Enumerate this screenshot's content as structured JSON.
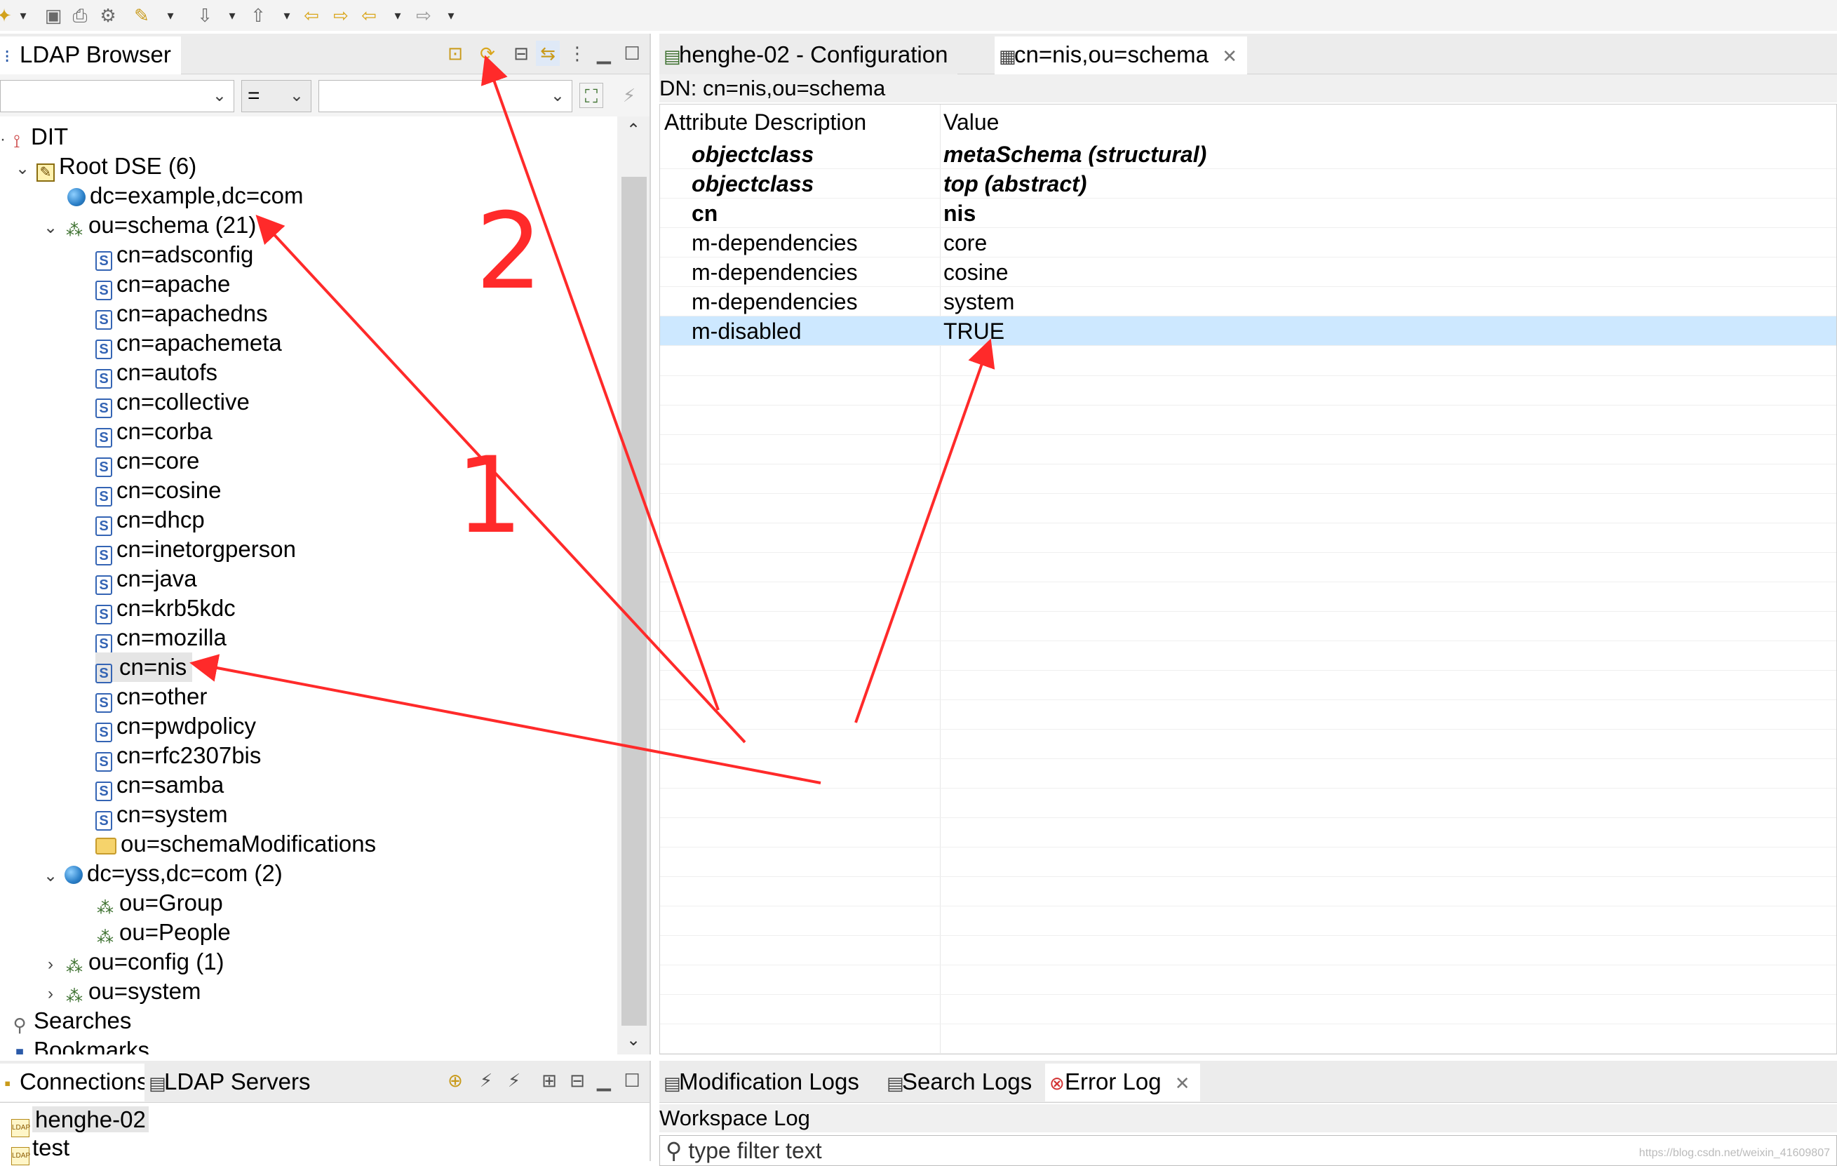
{
  "left_view": {
    "tab_label": "LDAP Browser",
    "filter": {
      "operator": "="
    }
  },
  "tree": {
    "root_label": "DIT",
    "root_dse": "Root DSE (6)",
    "example": "dc=example,dc=com",
    "schema": "ou=schema (21)",
    "schema_children": [
      "cn=adsconfig",
      "cn=apache",
      "cn=apachedns",
      "cn=apachemeta",
      "cn=autofs",
      "cn=collective",
      "cn=corba",
      "cn=core",
      "cn=cosine",
      "cn=dhcp",
      "cn=inetorgperson",
      "cn=java",
      "cn=krb5kdc",
      "cn=mozilla",
      "cn=nis",
      "cn=other",
      "cn=pwdpolicy",
      "cn=rfc2307bis",
      "cn=samba",
      "cn=system"
    ],
    "schema_mods": "ou=schemaModifications",
    "yss": "dc=yss,dc=com (2)",
    "yss_children": [
      "ou=Group",
      "ou=People"
    ],
    "config": "ou=config (1)",
    "system": "ou=system",
    "searches": "Searches",
    "bookmarks": "Bookmarks"
  },
  "editor": {
    "tabs": [
      "henghe-02 - Configuration",
      "cn=nis,ou=schema"
    ],
    "dn": "DN: cn=nis,ou=schema",
    "columns": [
      "Attribute Description",
      "Value"
    ],
    "rows": [
      {
        "attr": "objectclass",
        "value": "metaSchema (structural)"
      },
      {
        "attr": "objectclass",
        "value": "top (abstract)"
      },
      {
        "attr": "cn",
        "value": "nis"
      },
      {
        "attr": "m-dependencies",
        "value": "core"
      },
      {
        "attr": "m-dependencies",
        "value": "cosine"
      },
      {
        "attr": "m-dependencies",
        "value": "system"
      },
      {
        "attr": "m-disabled",
        "value": "TRUE"
      }
    ]
  },
  "connections": {
    "tabs": [
      "Connections",
      "LDAP Servers"
    ],
    "items": [
      "henghe-02",
      "test"
    ],
    "icon_text": "LDAP"
  },
  "logs": {
    "tabs": [
      "Modification Logs",
      "Search Logs",
      "Error Log"
    ],
    "workspace_log": "Workspace Log",
    "filter_placeholder": "type filter text"
  },
  "annotations": {
    "label_1": "1",
    "label_2": "2",
    "color": "#ff2a2a"
  },
  "watermark": "https://blog.csdn.net/weixin_41609807",
  "colors": {
    "selection": "#cde8ff",
    "annotation": "#ff2a2a"
  }
}
